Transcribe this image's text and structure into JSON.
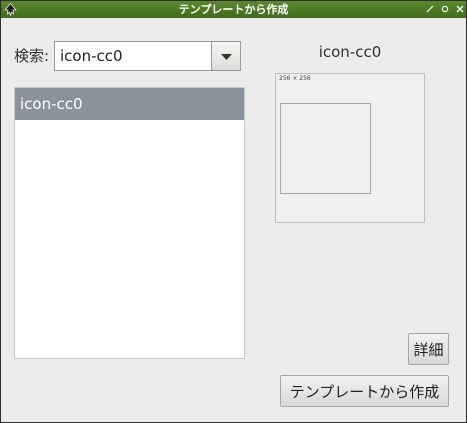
{
  "window": {
    "title": "テンプレートから作成"
  },
  "search": {
    "label": "検索:",
    "value": "icon-cc0"
  },
  "list": {
    "items": [
      {
        "label": "icon-cc0",
        "selected": true
      }
    ]
  },
  "preview": {
    "title": "icon-cc0",
    "size_label": "256 × 256"
  },
  "buttons": {
    "details": "詳細",
    "create": "テンプレートから作成"
  },
  "colors": {
    "titlebar": "#4a7a24",
    "selection": "#8a929c"
  }
}
